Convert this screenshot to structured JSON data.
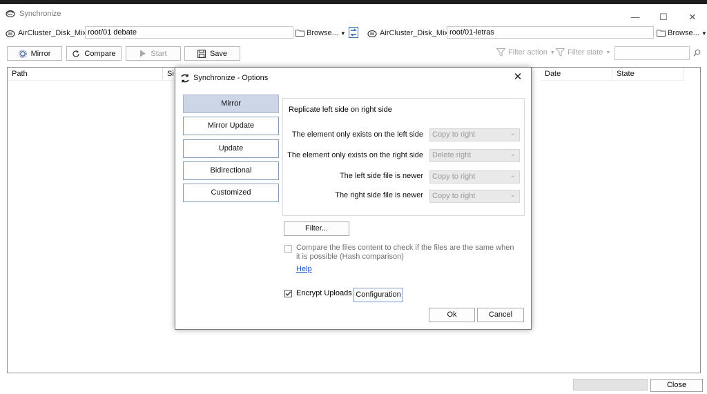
{
  "window": {
    "title": "Synchronize",
    "controls": {
      "minimize": "—",
      "maximize": "☐",
      "close": "✕"
    }
  },
  "left_side": {
    "service": "AirCluster_Disk_Mix",
    "path": "root/01 debate",
    "browse_label": "Browse..."
  },
  "right_side": {
    "service": "AirCluster_Disk_Mix",
    "path": "root/01-letras",
    "browse_label": "Browse..."
  },
  "toolbar": {
    "mirror_label": "Mirror",
    "compare_label": "Compare",
    "start_label": "Start",
    "save_label": "Save",
    "filter_action_label": "Filter action",
    "filter_state_label": "Filter state",
    "search_value": ""
  },
  "grid": {
    "columns": {
      "path": "Path",
      "size": "Si",
      "date": "Date",
      "state": "State"
    }
  },
  "status": {
    "close_label": "Close"
  },
  "dialog": {
    "title": "Synchronize - Options",
    "modes": [
      "Mirror",
      "Mirror Update",
      "Update",
      "Bidirectional",
      "Customized"
    ],
    "active_mode": "Mirror",
    "panel_title": "Replicate left side on right side",
    "rules": [
      {
        "label": "The element only exists on the left side",
        "value": "Copy to right"
      },
      {
        "label": "The element only exists on the right side",
        "value": "Delete right"
      },
      {
        "label": "The left side file is newer",
        "value": "Copy to right"
      },
      {
        "label": "The right side file is newer",
        "value": "Copy to right"
      }
    ],
    "filter_label": "Filter...",
    "hash_compare_label": "Compare the files content to check if the files are the same when it is possible (Hash comparison)",
    "help_label": "Help",
    "encrypt_label": "Encrypt Uploads",
    "configuration_label": "Configuration",
    "ok_label": "Ok",
    "cancel_label": "Cancel"
  },
  "colors": {
    "active_mode_bg": "#ccd6e6",
    "link": "#1a4fd0"
  }
}
